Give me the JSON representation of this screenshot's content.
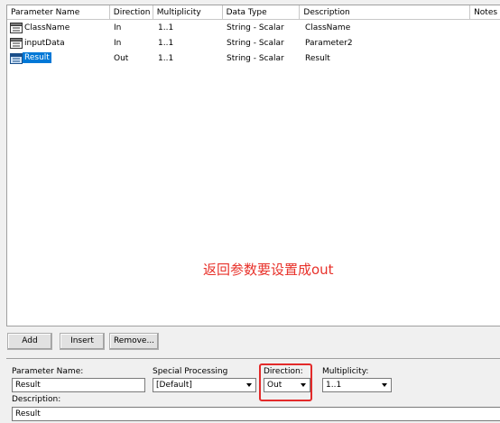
{
  "columns": [
    "Parameter Name",
    "Direction",
    "Multiplicity",
    "Data Type",
    "Description",
    "Notes"
  ],
  "rows": [
    {
      "name": "ClassName",
      "direction": "In",
      "multiplicity": "1..1",
      "data_type": "String - Scalar",
      "description": "ClassName",
      "selected": false
    },
    {
      "name": "inputData",
      "direction": "In",
      "multiplicity": "1..1",
      "data_type": "String - Scalar",
      "description": "Parameter2",
      "selected": false
    },
    {
      "name": "Result",
      "direction": "Out",
      "multiplicity": "1..1",
      "data_type": "String - Scalar",
      "description": "Result",
      "selected": true
    }
  ],
  "annotation": "返回参数要设置成out",
  "buttons": {
    "add": "Add",
    "insert": "Insert",
    "remove": "Remove..."
  },
  "form": {
    "param_name_label": "Parameter Name:",
    "param_name_value": "Result",
    "special_label": "Special Processing",
    "special_value": "[Default]",
    "direction_label": "Direction:",
    "direction_value": "Out",
    "multiplicity_label": "Multiplicity:",
    "multiplicity_value": "1..1",
    "description_label": "Description:",
    "description_value": "Result"
  },
  "colors": {
    "selection": "#0078d7",
    "annotation": "#e8312a",
    "highlight_box": "#e32a2a"
  }
}
